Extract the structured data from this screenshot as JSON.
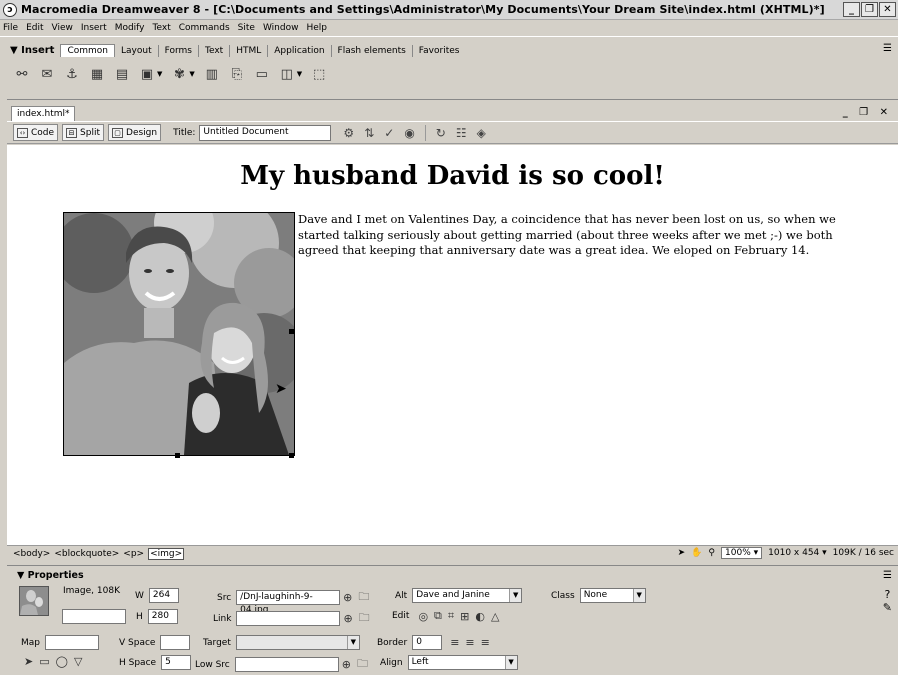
{
  "window": {
    "title": "Macromedia Dreamweaver 8 - [C:\\Documents and Settings\\Administrator\\My Documents\\Your Dream Site\\index.html (XHTML)*]",
    "controls": [
      "_",
      "❐",
      "✕"
    ]
  },
  "menu": [
    "File",
    "Edit",
    "View",
    "Insert",
    "Modify",
    "Text",
    "Commands",
    "Site",
    "Window",
    "Help"
  ],
  "insert_panel": {
    "label": "▼ Insert",
    "tabs": [
      "Common",
      "Layout",
      "Forms",
      "Text",
      "HTML",
      "Application",
      "Flash elements",
      "Favorites"
    ],
    "active_tab": "Common",
    "icons": [
      "hyperlink-icon",
      "email-link-icon",
      "named-anchor-icon",
      "table-icon",
      "layer-icon",
      "images-icon",
      "media-icon",
      "date-icon",
      "comment-icon",
      "head-icon",
      "templates-icon",
      "tag-chooser-icon"
    ]
  },
  "document": {
    "tab_label": "index.html*",
    "view_buttons": [
      "Code",
      "Split",
      "Design"
    ],
    "title_label": "Title:",
    "title_value": "Untitled Document",
    "heading": "My husband David is so cool!",
    "paragraph": "Dave and I met on Valentines Day, a coincidence that has never been lost on us, so when we started talking seriously about getting married (about three weeks after we met ;-) we both agreed that keeping that anniversary date was a great idea. We eloped on February 14."
  },
  "status_bar": {
    "tags": [
      "<body>",
      "<blockquote>",
      "<p>",
      "<img>"
    ],
    "zoom": "100%",
    "window_size": "1010 x 454",
    "download": "109K / 16 sec"
  },
  "properties": {
    "header": "▼ Properties",
    "type_label": "Image, 108K",
    "w_label": "W",
    "w_value": "264",
    "h_label": "H",
    "h_value": "280",
    "src_label": "Src",
    "src_value": "/DnJ-laughinh-9-04.jpg",
    "alt_label": "Alt",
    "alt_value": "Dave and Janine",
    "class_label": "Class",
    "class_value": "None",
    "link_label": "Link",
    "link_value": "",
    "edit_label": "Edit",
    "map_label": "Map",
    "map_value": "",
    "vspace_label": "V Space",
    "vspace_value": "",
    "target_label": "Target",
    "target_value": "",
    "border_label": "Border",
    "border_value": "0",
    "hspace_label": "H Space",
    "hspace_value": "5",
    "lowsrc_label": "Low Src",
    "lowsrc_value": "",
    "align_label": "Align",
    "align_value": "Left"
  }
}
